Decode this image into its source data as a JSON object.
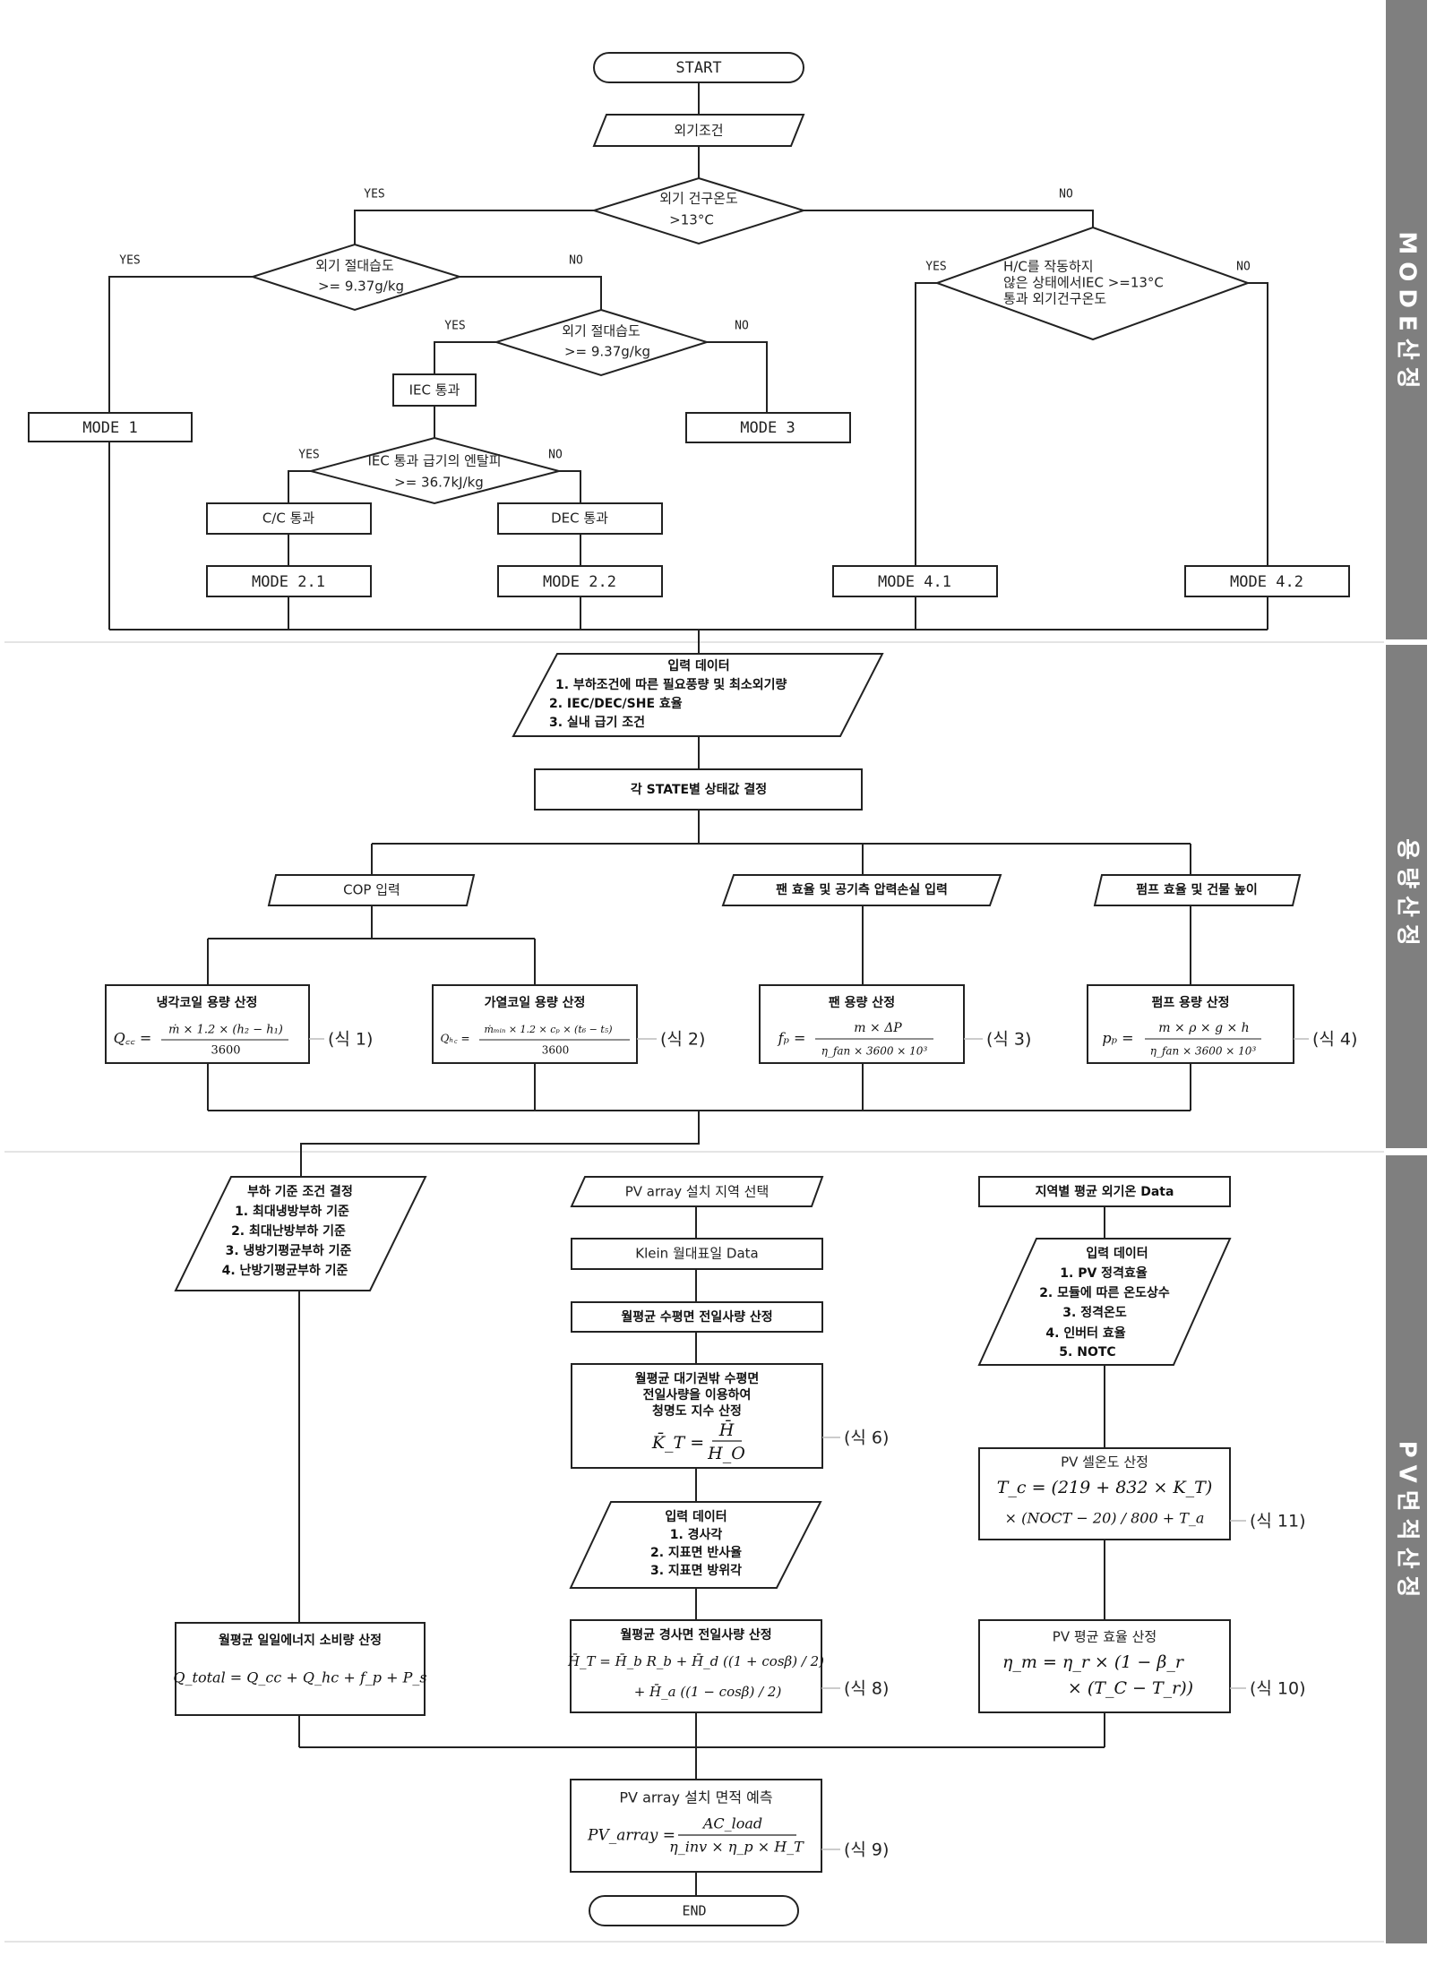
{
  "sections": [
    {
      "label": "MODE산정"
    },
    {
      "label": "용량산정"
    },
    {
      "label": "PV면적산정"
    }
  ],
  "mode": {
    "start": "START",
    "input": "외기조건",
    "d1": {
      "line1": "외기 건구온도",
      "line2": ">13°C",
      "yes": "YES",
      "no": "NO"
    },
    "d2": {
      "line1": "외기 절대습도",
      "line2": ">= 9.37g/kg",
      "yes": "YES",
      "no": "NO"
    },
    "d3": {
      "line1": "외기 절대습도",
      "line2": ">= 9.37g/kg",
      "yes": "YES",
      "no": "NO"
    },
    "d4": {
      "line1": "H/C를 작동하지",
      "line2": "않은 상태에서IEC  >=13°C",
      "line3": "통과 외기건구온도",
      "yes": "YES",
      "no": "NO"
    },
    "d5": {
      "line1": "IEC 통과 급기의 엔탈피",
      "line2": ">= 36.7kJ/kg",
      "yes": "YES",
      "no": "NO"
    },
    "iec": "IEC 통과",
    "cc": "C/C 통과",
    "dec": "DEC 통과",
    "mode1": "MODE 1",
    "mode3": "MODE 3",
    "mode21": "MODE 2.1",
    "mode22": "MODE 2.2",
    "mode41": "MODE 4.1",
    "mode42": "MODE 4.2"
  },
  "capacity": {
    "input": {
      "title": "입력 데이터",
      "items": [
        "1. 부하조건에 따른 필요풍량 및 최소외기량",
        "2. IEC/DEC/SHE 효율",
        "3. 실내 급기 조건"
      ]
    },
    "state": "각 STATE별 상태값 결정",
    "cop": "COP 입력",
    "fan_in": "팬 효율 및 공기측 압력손실 입력",
    "pump_in": "펌프 효율 및 건물 높이",
    "boxes": [
      {
        "title": "냉각코일 용량 산정",
        "lhs": "Q꜀꜀ =",
        "num": "ṁ × 1.2 × (h₂ − h₁)",
        "den": "3600",
        "ref": "(식 1)"
      },
      {
        "title": "가열코일 용량 산정",
        "lhs": "Qₕ꜀ =",
        "num": "ṁₘᵢₙ × 1.2 × cₚ × (t₆ − t₅)",
        "den": "3600",
        "ref": "(식 2)"
      },
      {
        "title": "팬 용량 산정",
        "lhs": "fₚ =",
        "num": "m × ΔP",
        "den": "η_fan × 3600 × 10³",
        "ref": "(식 3)"
      },
      {
        "title": "펌프 용량 산정",
        "lhs": "pₚ =",
        "num": "m × ρ × g × h",
        "den": "η_fan × 3600 × 10³",
        "ref": "(식 4)"
      }
    ]
  },
  "pv": {
    "load": {
      "title": "부하 기준 조건 결정",
      "items": [
        "1. 최대냉방부하 기준",
        "2. 최대난방부하 기준",
        "3. 냉방기평균부하 기준",
        "4. 난방기평균부하 기준"
      ]
    },
    "site": "PV array 설치 지역 선택",
    "klein": "Klein 월대표일 Data",
    "horiz": "월평균 수평면 전일사량 산정",
    "kt": {
      "lines": [
        "월평균 대기권밖 수평면",
        "전일사량을 이용하여",
        "청명도 지수 산정"
      ],
      "lhs": "K̄_T =",
      "num": "H̄",
      "den": "H_O",
      "ref": "(식 6)"
    },
    "input2": {
      "title": "입력 데이터",
      "items": [
        "1. 경사각",
        "2. 지표면 반사율",
        "3. 지표면 방위각"
      ]
    },
    "tilt": {
      "title": "월평균 경사면 전일사량 산정",
      "line1": "H̄_T = H̄_b R_b + H̄_d ((1 + cosβ) / 2)",
      "line2": "+ H̄_a ((1 − cosβ) / 2)",
      "ref": "(식 8)"
    },
    "qtotal": {
      "title": "월평균 일일에너지 소비량 산정",
      "eq": "Q_total = Q_cc + Q_hc + f_p + P_s"
    },
    "temp": "지역별 평균 외기온 Data",
    "input3": {
      "title": "입력 데이터",
      "items": [
        "1. PV 정격효율",
        "2. 모듈에 따른 온도상수",
        "3. 정격온도",
        "4. 인버터 효율",
        "5. NOTC"
      ]
    },
    "cell": {
      "title": "PV 셀온도 산정",
      "line1": "T_c = (219 + 832 × K_T)",
      "line2": "× (NOCT − 20) / 800 + T_a",
      "ref": "(식 11)"
    },
    "eff": {
      "title": "PV 평균 효율 산정",
      "line1": "η_m = η_r × (1 − β_r",
      "line2": "× (T_C − T_r))",
      "ref": "(식 10)"
    },
    "area": {
      "title": "PV array 설치 면적 예측",
      "lhs": "PV_array =",
      "num": "AC_load",
      "den": "η_inv × η_p × H_T",
      "ref": "(식 9)"
    },
    "end": "END"
  }
}
